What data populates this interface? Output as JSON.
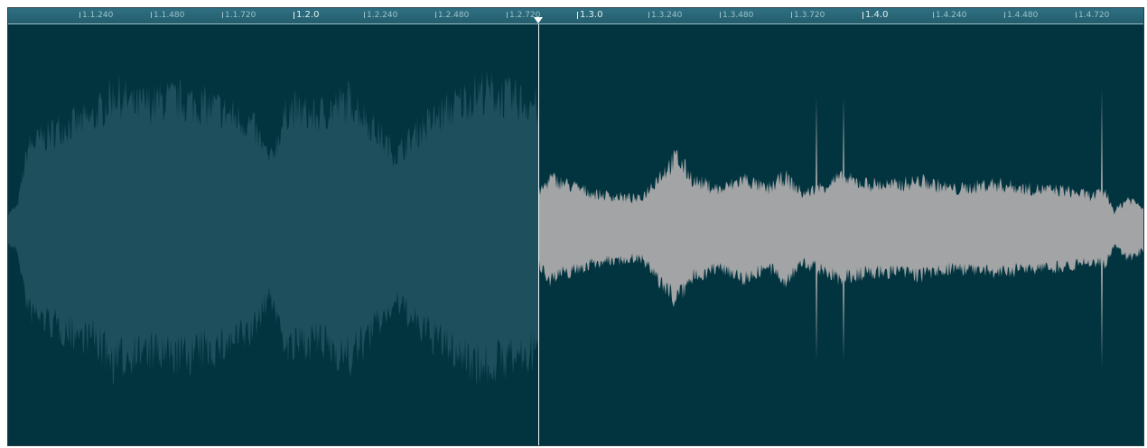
{
  "timeline": {
    "ticks": [
      {
        "label": "1.1.240",
        "major": false
      },
      {
        "label": "1.1.480",
        "major": false
      },
      {
        "label": "1.1.720",
        "major": false
      },
      {
        "label": "1.2.0",
        "major": true
      },
      {
        "label": "1.2.240",
        "major": false
      },
      {
        "label": "1.2.480",
        "major": false
      },
      {
        "label": "1.2.720",
        "major": false
      },
      {
        "label": "1.3.0",
        "major": true
      },
      {
        "label": "1.3.240",
        "major": false
      },
      {
        "label": "1.3.480",
        "major": false
      },
      {
        "label": "1.3.720",
        "major": false
      },
      {
        "label": "1.4.0",
        "major": true
      },
      {
        "label": "1.4.240",
        "major": false
      },
      {
        "label": "1.4.480",
        "major": false
      },
      {
        "label": "1.4.720",
        "major": false
      }
    ]
  },
  "colors": {
    "background": "#023440",
    "played_waveform": "#1e4f5c",
    "unplayed_waveform": "#a2a4a5",
    "playhead": "#f2f6f7",
    "ruler": "#2a6777"
  }
}
